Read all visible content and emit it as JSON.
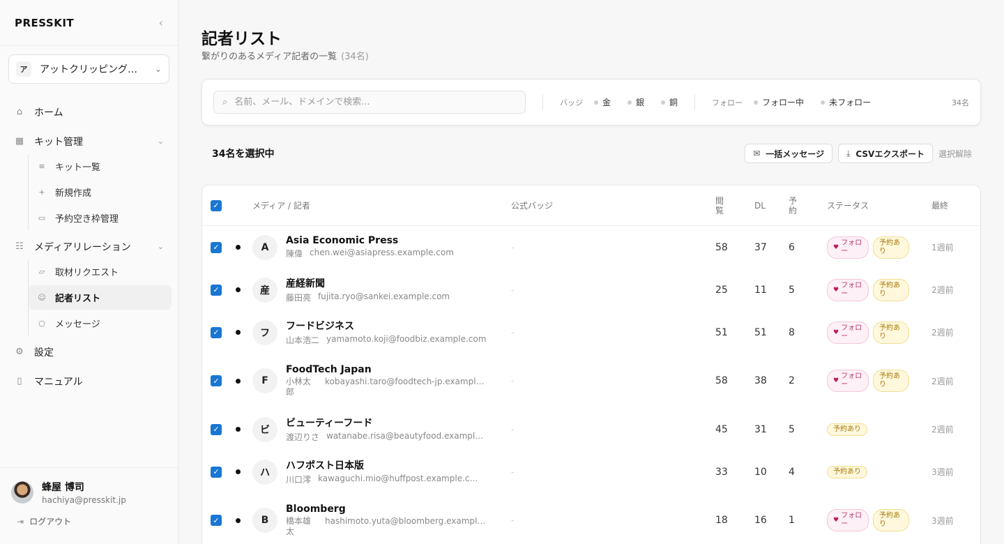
{
  "app": {
    "logo": "PRESSKIT",
    "collapse_icon": "chevron-left-icon"
  },
  "org": {
    "avatar": "ア",
    "name": "アットクリッピング株式会社"
  },
  "nav": {
    "home": "ホーム",
    "kit": "キット管理",
    "kit_list": "キット一覧",
    "kit_new": "新規作成",
    "kit_slots": "予約空き枠管理",
    "media": "メディアリレーション",
    "requests": "取材リクエスト",
    "reporters": "記者リスト",
    "messages": "メッセージ",
    "settings": "設定",
    "manual": "マニュアル"
  },
  "user": {
    "name": "蜂屋 博司",
    "email": "hachiya@presskit.jp",
    "logout": "ログアウト"
  },
  "page": {
    "title": "記者リスト",
    "subtitle": "繋がりのあるメディア記者の一覧",
    "count": "(34名)"
  },
  "filter": {
    "search_placeholder": "名前、メール、ドメインで検索...",
    "badge_label": "バッジ",
    "badge_gold": "金",
    "badge_silver": "銀",
    "badge_bronze": "銅",
    "follow_label": "フォロー",
    "following": "フォロー中",
    "not_following": "未フォロー",
    "count": "34名"
  },
  "selection": {
    "text": "34名を選択中",
    "bulk_message": "一括メッセージ",
    "csv_export": "CSVエクスポート",
    "clear": "選択解除"
  },
  "table": {
    "headers": {
      "media": "メディア / 記者",
      "badge": "公式バッジ",
      "views": "閲\n覧",
      "dl": "DL",
      "reservations": "予\n約",
      "status": "ステータス",
      "last": "最終"
    },
    "follow_pill": "フォロー",
    "reserved_pill": "予約あり",
    "rows": [
      {
        "avatar": "A",
        "media": "Asia Economic Press",
        "name": "陳偉",
        "email": "chen.wei@asiapress.example.com",
        "badge": "-",
        "views": "58",
        "dl": "37",
        "res": "6",
        "last": "1週前"
      },
      {
        "avatar": "産",
        "media": "産経新聞",
        "name": "藤田亮",
        "email": "fujita.ryo@sankei.example.com",
        "badge": "-",
        "views": "25",
        "dl": "11",
        "res": "5",
        "last": "2週前"
      },
      {
        "avatar": "フ",
        "media": "フードビジネス",
        "name": "山本浩二",
        "email": "yamamoto.koji@foodbiz.example.com",
        "badge": "-",
        "views": "51",
        "dl": "51",
        "res": "8",
        "last": "2週前"
      },
      {
        "avatar": "F",
        "media": "FoodTech Japan",
        "name": "小林太郎",
        "email": "kobayashi.taro@foodtech-jp.example.com",
        "badge": "-",
        "views": "58",
        "dl": "38",
        "res": "2",
        "last": "2週前"
      },
      {
        "avatar": "ビ",
        "media": "ビューティーフード",
        "name": "渡辺りさ",
        "email": "watanabe.risa@beautyfood.example.com",
        "badge": "-",
        "views": "45",
        "dl": "31",
        "res": "5",
        "last": "2週前"
      },
      {
        "avatar": "ハ",
        "media": "ハフポスト日本版",
        "name": "川口澪",
        "email": "kawaguchi.mio@huffpost.example.com",
        "badge": "-",
        "views": "33",
        "dl": "10",
        "res": "4",
        "last": "3週前"
      },
      {
        "avatar": "B",
        "media": "Bloomberg",
        "name": "橋本雄太",
        "email": "hashimoto.yuta@bloomberg.example.com",
        "badge": "-",
        "views": "18",
        "dl": "16",
        "res": "1",
        "last": "3週前"
      }
    ]
  }
}
